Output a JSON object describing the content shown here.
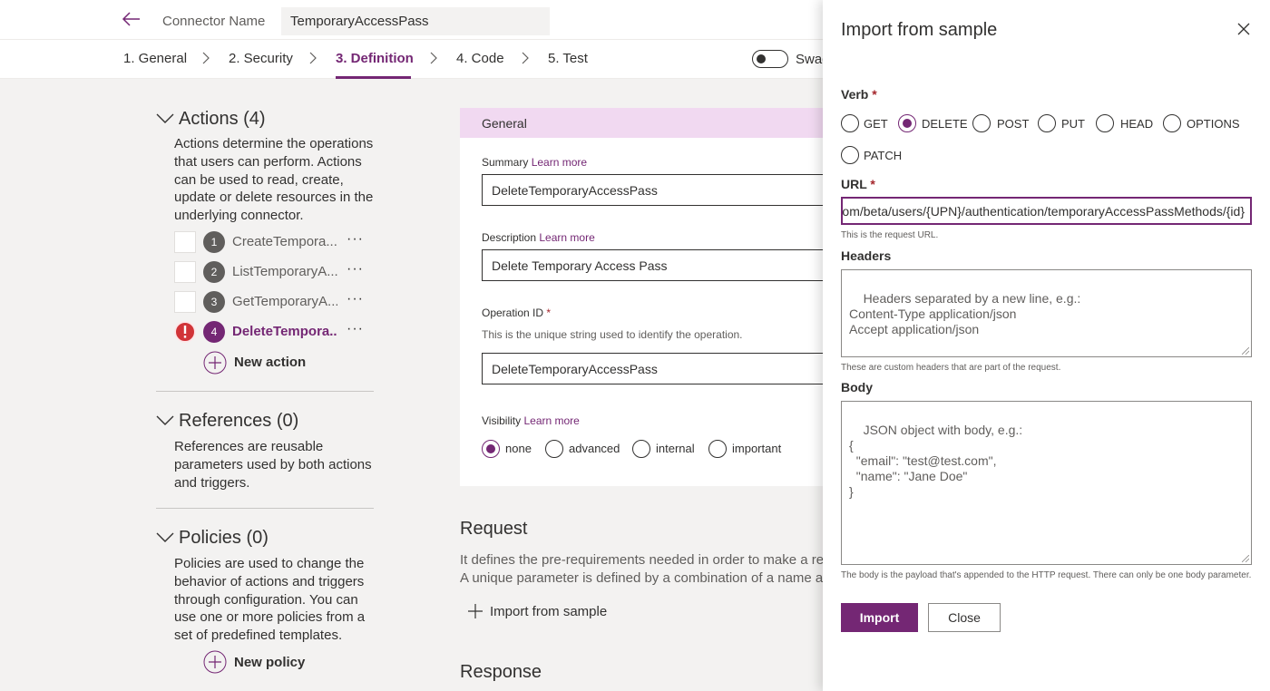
{
  "header": {
    "connector_label": "Connector Name",
    "connector_value": "TemporaryAccessPass"
  },
  "steps": [
    {
      "label": "1. General"
    },
    {
      "label": "2. Security"
    },
    {
      "label": "3. Definition"
    },
    {
      "label": "4. Code"
    },
    {
      "label": "5. Test"
    }
  ],
  "swagger_label": "Swag",
  "left": {
    "actions_title": "Actions (4)",
    "actions_desc": "Actions determine the operations that users can perform. Actions can be used to read, create, update or delete resources in the underlying connector.",
    "actions": [
      {
        "num": "1",
        "name": "CreateTempora...",
        "dots": "···"
      },
      {
        "num": "2",
        "name": "ListTemporaryA...",
        "dots": "···"
      },
      {
        "num": "3",
        "name": "GetTemporaryA...",
        "dots": "···"
      },
      {
        "num": "4",
        "name": "DeleteTempora...",
        "dots": "···"
      }
    ],
    "new_action": "New action",
    "references_title": "References (0)",
    "references_desc": "References are reusable parameters used by both actions and triggers.",
    "policies_title": "Policies (0)",
    "policies_desc": "Policies are used to change the behavior of actions and triggers through configuration. You can use one or more policies from a set of predefined templates.",
    "new_policy": "New policy"
  },
  "card": {
    "header": "General",
    "summary_label": "Summary",
    "learn_more": "Learn more",
    "summary_value": "DeleteTemporaryAccessPass",
    "description_label": "Description",
    "description_value": "Delete Temporary Access Pass",
    "opid_label": "Operation ID",
    "required_mark": "*",
    "opid_hint": "This is the unique string used to identify the operation.",
    "opid_value": "DeleteTemporaryAccessPass",
    "visibility_label": "Visibility",
    "visibility_options": [
      {
        "label": "none",
        "selected": true
      },
      {
        "label": "advanced",
        "selected": false
      },
      {
        "label": "internal",
        "selected": false
      },
      {
        "label": "important",
        "selected": false
      }
    ]
  },
  "request": {
    "title": "Request",
    "line1": "It defines the pre-requirements needed in order to make a reque",
    "line2": "A unique parameter is defined by a combination of a name and l",
    "import_link": "Import from sample"
  },
  "response": {
    "title": "Response"
  },
  "panel": {
    "title": "Import from sample",
    "verb_label": "Verb",
    "required_mark": "*",
    "verbs": [
      {
        "label": "GET",
        "selected": false
      },
      {
        "label": "DELETE",
        "selected": true
      },
      {
        "label": "POST",
        "selected": false
      },
      {
        "label": "PUT",
        "selected": false
      },
      {
        "label": "HEAD",
        "selected": false
      },
      {
        "label": "OPTIONS",
        "selected": false
      },
      {
        "label": "PATCH",
        "selected": false
      }
    ],
    "url_label": "URL",
    "url_value": "om/beta/users/{UPN}/authentication/temporaryAccessPassMethods/{id}",
    "url_hint": "This is the request URL.",
    "headers_label": "Headers",
    "headers_placeholder": "Headers separated by a new line, e.g.:\nContent-Type application/json\nAccept application/json",
    "headers_hint": "These are custom headers that are part of the request.",
    "body_label": "Body",
    "body_placeholder": "JSON object with body, e.g.:\n{\n  \"email\": \"test@test.com\",\n  \"name\": \"Jane Doe\"\n}",
    "body_hint": "The body is the payload that's appended to the HTTP request. There can only be one body parameter.",
    "import_button": "Import",
    "close_button": "Close"
  },
  "colors": {
    "accent": "#742774",
    "header_tint": "#f1d9f1",
    "error": "#d13438"
  }
}
